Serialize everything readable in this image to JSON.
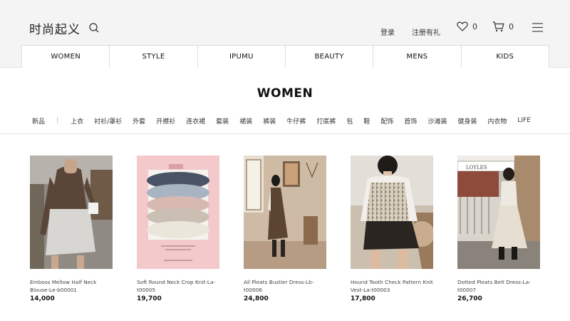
{
  "header": {
    "logo": "时尚起义",
    "login": "登录",
    "register": "注册有礼",
    "wishlist_count": "0",
    "cart_count": "0"
  },
  "categories": [
    "WOMEN",
    "STYLE",
    "IPUMU",
    "BEAUTY",
    "MENS",
    "KIDS"
  ],
  "page_title": "WOMEN",
  "subnav": {
    "first": "新品",
    "items": [
      "上衣",
      "衬衫/罩衫",
      "外套",
      "开襟衫",
      "连衣裙",
      "套装",
      "裙装",
      "裤装",
      "牛仔裤",
      "打底裤",
      "包",
      "鞋",
      "配饰",
      "首饰",
      "沙滩装",
      "健身装",
      "内衣物",
      "LIFE"
    ]
  },
  "products": [
    {
      "name": "Emboss Mellow Half Neck Blouse-Le-b00001",
      "price": "14,000"
    },
    {
      "name": "Soft Round Neck Crop Knit-La-t00005",
      "price": "19,700"
    },
    {
      "name": "All Pleats Bustier Dress-Lb-t00006",
      "price": "24,800"
    },
    {
      "name": "Hound Tooth Check Pattern Knit Vest-La-t00003",
      "price": "17,800"
    },
    {
      "name": "Dotted Pleats Belt Dress-La-t00007",
      "price": "26,700"
    }
  ],
  "product_sign_text": "LOYLES",
  "colors": {
    "header_bg": "#f4f4f4",
    "knit_card_bg": "#f3c9cc"
  }
}
